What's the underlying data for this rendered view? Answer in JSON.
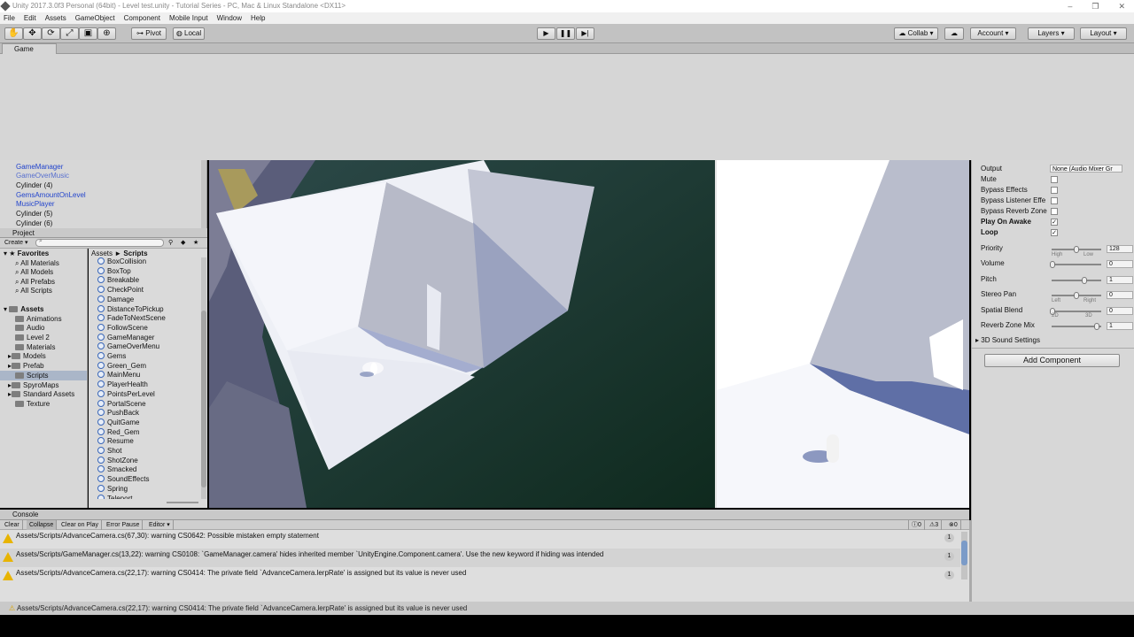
{
  "window": {
    "title": "Unity 2017.3.0f3 Personal (64bit) - Level test.unity - Tutorial Series - PC, Mac & Linux Standalone <DX11>",
    "controls": [
      "‒",
      "❐",
      "✕"
    ]
  },
  "menu": [
    "File",
    "Edit",
    "Assets",
    "GameObject",
    "Component",
    "Mobile Input",
    "Window",
    "Help"
  ],
  "toolbar": {
    "tools": [
      "hand-icon",
      "move-icon",
      "rotate-icon",
      "scale-icon",
      "rect-icon",
      "transform-icon"
    ],
    "pivot": "Pivot",
    "local": "Local",
    "collab": "Collab",
    "account": "Account",
    "layers": "Layers",
    "layout": "Layout"
  },
  "game_tab": "Game",
  "hierarchy": {
    "items": [
      {
        "label": "GameManager",
        "blue": true
      },
      {
        "label": "GameOverMusic",
        "blue": true
      },
      {
        "label": "Cylinder (4)",
        "blue": false
      },
      {
        "label": "GemsAmountOnLevel",
        "blue": true
      },
      {
        "label": "MusicPlayer",
        "blue": true
      },
      {
        "label": "Cylinder (5)",
        "blue": false
      },
      {
        "label": "Cylinder (6)",
        "blue": false
      }
    ]
  },
  "project": {
    "tab": "Project",
    "create": "Create",
    "favorites_label": "Favorites",
    "favorites": [
      "All Materials",
      "All Models",
      "All Prefabs",
      "All Scripts"
    ],
    "assets_label": "Assets",
    "folders": [
      "Animations",
      "Audio",
      "Level 2",
      "Materials",
      "Models",
      "Prefab",
      "Scripts",
      "SpyroMaps",
      "Standard Assets",
      "Texture"
    ],
    "breadcrumb": {
      "root": "Assets",
      "sep": "►",
      "current": "Scripts"
    },
    "scripts": [
      "BoxCollision",
      "BoxTop",
      "Breakable",
      "CheckPoint",
      "Damage",
      "DistanceToPickup",
      "FadeToNextScene",
      "FollowScene",
      "GameManager",
      "GameOverMenu",
      "Gems",
      "Green_Gem",
      "MainMenu",
      "PlayerHealth",
      "PointsPerLevel",
      "PortalScene",
      "PushBack",
      "QuitGame",
      "Red_Gem",
      "Resume",
      "Shot",
      "ShotZone",
      "Smacked",
      "SoundEffects",
      "Spring",
      "Teleport"
    ]
  },
  "inspector": {
    "output_label": "Output",
    "output_value": "None (Audio Mixer Gr",
    "toggles": [
      {
        "label": "Mute",
        "checked": false,
        "bold": false
      },
      {
        "label": "Bypass Effects",
        "checked": false,
        "bold": false
      },
      {
        "label": "Bypass Listener Effe",
        "checked": false,
        "bold": false
      },
      {
        "label": "Bypass Reverb Zone",
        "checked": false,
        "bold": false
      },
      {
        "label": "Play On Awake",
        "checked": true,
        "bold": true
      },
      {
        "label": "Loop",
        "checked": true,
        "bold": true
      }
    ],
    "sliders": [
      {
        "label": "Priority",
        "value": "128",
        "pos": 0.5,
        "low": "High",
        "high": "Low"
      },
      {
        "label": "Volume",
        "value": "0",
        "pos": 0.0
      },
      {
        "label": "Pitch",
        "value": "1",
        "pos": 0.66
      },
      {
        "label": "Stereo Pan",
        "value": "0",
        "pos": 0.5,
        "low": "Left",
        "high": "Right"
      },
      {
        "label": "Spatial Blend",
        "value": "0",
        "pos": 0.0,
        "low": "2D",
        "high": "3D"
      },
      {
        "label": "Reverb Zone Mix",
        "value": "1",
        "pos": 0.92
      }
    ],
    "sound3d": "3D Sound Settings",
    "add_component": "Add Component"
  },
  "console": {
    "tab": "Console",
    "buttons": [
      "Clear",
      "Collapse",
      "Clear on Play",
      "Error Pause",
      "Editor ▾"
    ],
    "counts": {
      "errors": "0",
      "warnings": "3",
      "messages": "0"
    },
    "rows": [
      {
        "text": "Assets/Scripts/AdvanceCamera.cs(67,30): warning CS0642: Possible mistaken empty statement",
        "count": "1"
      },
      {
        "text": "Assets/Scripts/GameManager.cs(13,22): warning CS0108: `GameManager.camera' hides inherited member `UnityEngine.Component.camera'. Use the new keyword if hiding was intended",
        "count": "1"
      },
      {
        "text": "Assets/Scripts/AdvanceCamera.cs(22,17): warning CS0414: The private field `AdvanceCamera.lerpRate' is assigned but its value is never used",
        "count": "1"
      }
    ]
  },
  "status": "Assets/Scripts/AdvanceCamera.cs(22,17): warning CS0414: The private field `AdvanceCamera.lerpRate' is assigned but its value is never used",
  "colors": {
    "accent_blue": "#2244cc",
    "warning_yellow": "#e8b400",
    "panel": "#d7d7d7"
  }
}
